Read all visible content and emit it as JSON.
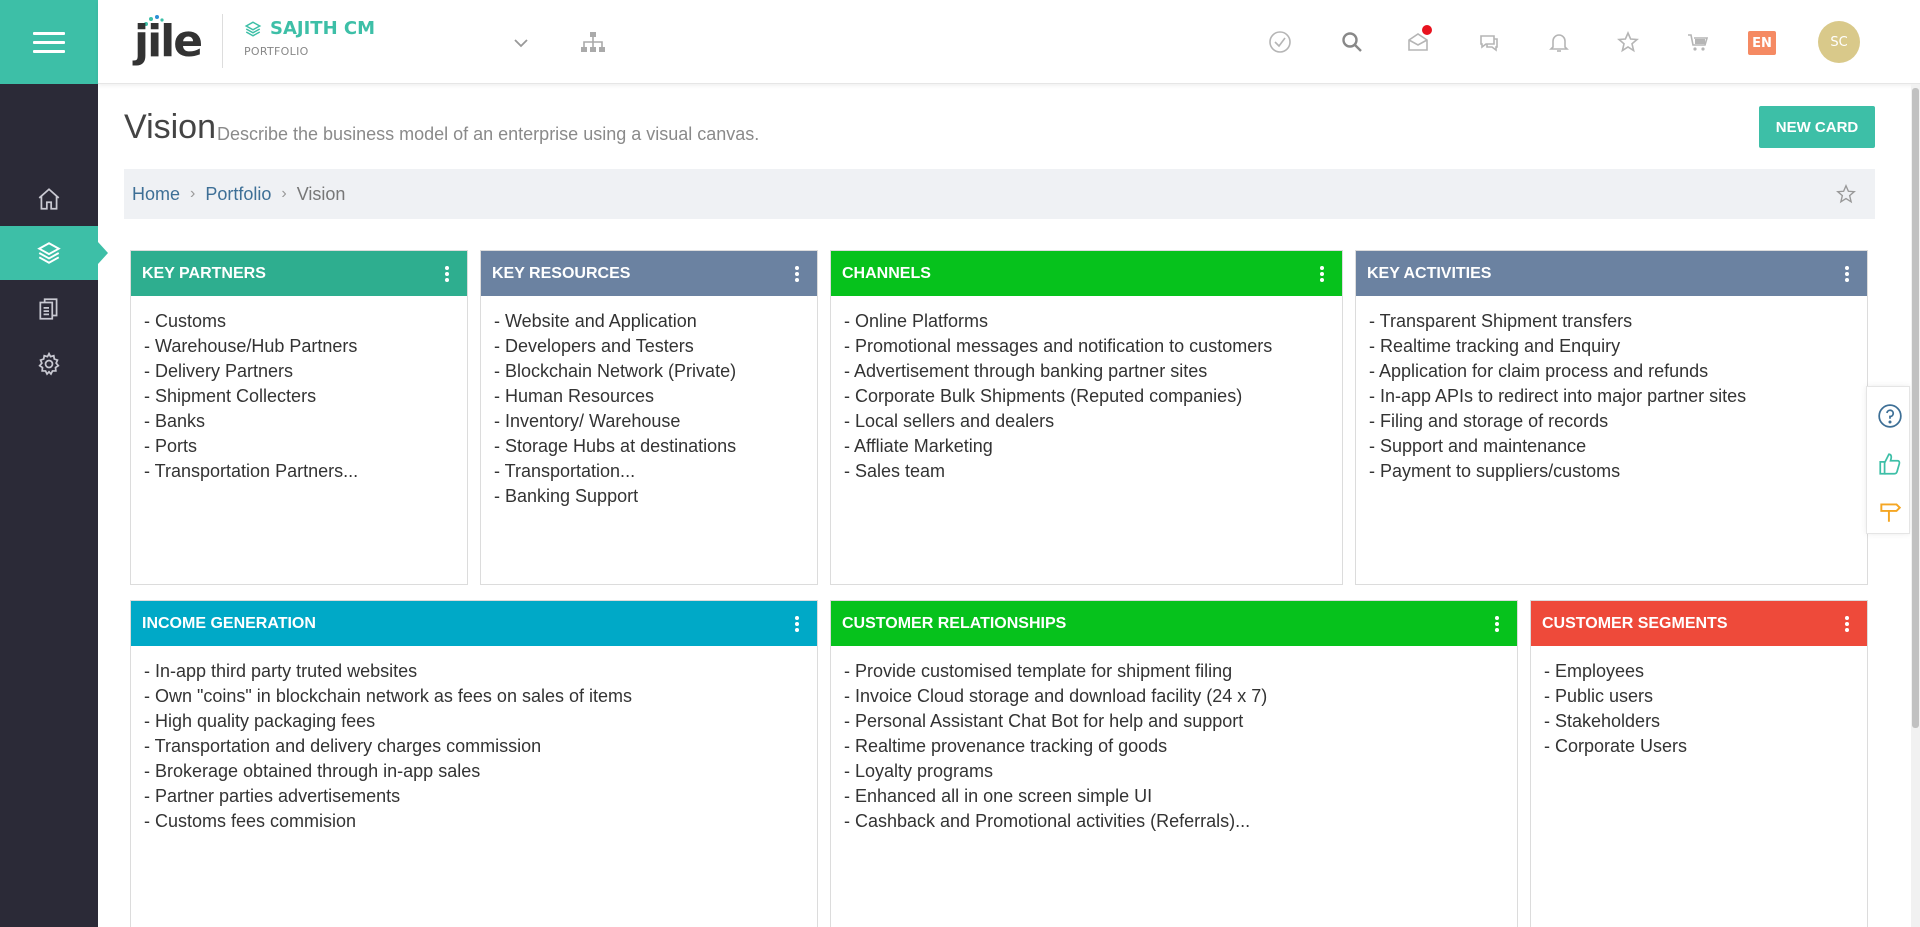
{
  "app": {
    "logo_text": "jile"
  },
  "project": {
    "name": "SAJITH CM",
    "subtitle": "PORTFOLIO"
  },
  "topbar": {
    "icons": [
      "check-circle-icon",
      "search-icon",
      "mail-icon",
      "chat-icon",
      "bell-icon",
      "star-icon",
      "cart-icon"
    ],
    "language": "EN",
    "avatar_initials": "SC",
    "colors": {
      "accent": "#3dbfa7",
      "lang_badge": "#f58a63",
      "avatar": "#d9c98a",
      "notification": "#e8121e"
    }
  },
  "sidebar": {
    "items": [
      {
        "icon": "home-icon"
      },
      {
        "icon": "layers-icon",
        "active": true
      },
      {
        "icon": "documents-icon"
      },
      {
        "icon": "gear-icon"
      }
    ]
  },
  "page": {
    "title": "Vision",
    "description": "Describe the business model of an enterprise using a visual canvas.",
    "new_card_label": "NEW CARD"
  },
  "breadcrumb": {
    "items": [
      "Home",
      "Portfolio",
      "Vision"
    ]
  },
  "cards": {
    "key_partners": {
      "title": "KEY PARTNERS",
      "color": "#2eae8f",
      "items": [
        "- Customs",
        "- Warehouse/Hub Partners",
        "- Delivery Partners",
        "- Shipment Collecters",
        "- Banks",
        "- Ports",
        "- Transportation Partners..."
      ]
    },
    "key_resources": {
      "title": "KEY RESOURCES",
      "color": "#6b82a1",
      "items": [
        "- Website and Application",
        "- Developers and Testers",
        "- Blockchain Network (Private)",
        "- Human Resources",
        "- Inventory/ Warehouse",
        "- Storage Hubs at destinations",
        "- Transportation...",
        "- Banking Support"
      ]
    },
    "channels": {
      "title": "CHANNELS",
      "color": "#06c21c",
      "items": [
        "- Online Platforms",
        "- Promotional messages and notification to customers",
        "- Advertisement through banking partner sites",
        "- Corporate Bulk Shipments (Reputed companies)",
        "- Local sellers and dealers",
        "- Affliate Marketing",
        "- Sales team"
      ]
    },
    "key_activities": {
      "title": "KEY ACTIVITIES",
      "color": "#6b82a1",
      "items": [
        "- Transparent Shipment transfers",
        "- Realtime tracking and Enquiry",
        "- Application for claim process and refunds",
        "- In-app APIs to redirect into major partner sites",
        "- Filing and storage of records",
        "- Support and maintenance",
        "- Payment to suppliers/customs"
      ]
    },
    "income_generation": {
      "title": "INCOME GENERATION",
      "color": "#00a9c7",
      "items": [
        "- In-app third party truted websites",
        "- Own \"coins\" in blockchain network as fees on sales of items",
        "- High quality packaging fees",
        "- Transportation and delivery charges commission",
        "- Brokerage obtained through in-app sales",
        "- Partner parties advertisements",
        "- Customs fees commision"
      ]
    },
    "customer_relationships": {
      "title": "CUSTOMER RELATIONSHIPS",
      "color": "#06c21c",
      "items": [
        "- Provide customised template for shipment filing",
        "- Invoice Cloud storage and download facility (24 x 7)",
        "- Personal Assistant Chat Bot for help and support",
        "- Realtime provenance tracking of goods",
        "- Loyalty programs",
        "- Enhanced all in one screen simple UI",
        "- Cashback and Promotional activities (Referrals)..."
      ]
    },
    "customer_segments": {
      "title": "CUSTOMER SEGMENTS",
      "color": "#ee4a3a",
      "items": [
        "- Employees",
        "- Public users",
        "- Stakeholders",
        "- Corporate Users"
      ]
    }
  },
  "float_panel": {
    "icons": [
      "help-icon",
      "thumbs-up-icon",
      "signpost-icon"
    ]
  }
}
